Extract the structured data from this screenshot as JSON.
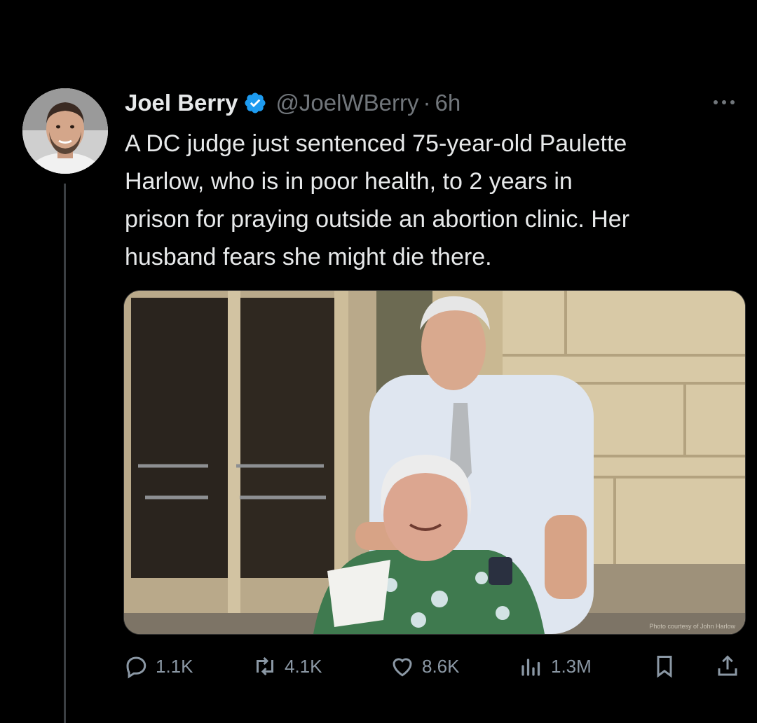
{
  "tweet": {
    "author_name": "Joel Berry",
    "handle": "@JoelWBerry",
    "separator": "·",
    "time": "6h",
    "text": "A DC judge just sentenced 75-year-old Paulette\nHarlow, who is in poor health, to 2 years in\nprison for praying outside an abortion clinic. Her\nhusband fears she might die there.",
    "photo_credit": "Photo courtesy of John Harlow"
  },
  "actions": {
    "replies": "1.1K",
    "reposts": "4.1K",
    "likes": "8.6K",
    "views": "1.3M"
  },
  "colors": {
    "background": "#000000",
    "text": "#e7e9ea",
    "secondary": "#71767b",
    "verified": "#1d9bf0"
  },
  "icons": [
    "more-icon",
    "verified-badge-icon",
    "reply-icon",
    "repost-icon",
    "like-icon",
    "views-icon",
    "bookmark-icon",
    "share-icon"
  ]
}
